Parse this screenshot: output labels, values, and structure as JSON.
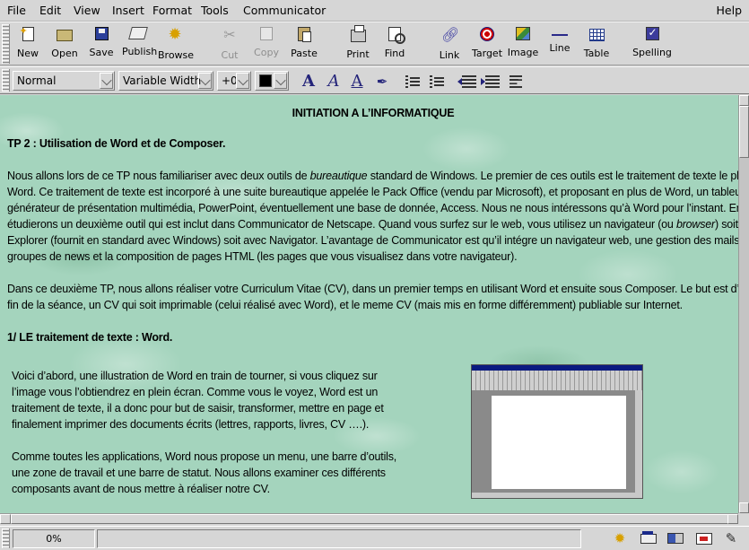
{
  "menu": {
    "file": "File",
    "edit": "Edit",
    "view": "View",
    "insert": "Insert",
    "format": "Format",
    "tools": "Tools",
    "communicator": "Communicator",
    "help": "Help"
  },
  "toolbar": {
    "new": "New",
    "open": "Open",
    "save": "Save",
    "publish": "Publish",
    "browse": "Browse",
    "cut": "Cut",
    "copy": "Copy",
    "paste": "Paste",
    "print": "Print",
    "find": "Find",
    "link": "Link",
    "target": "Target",
    "image": "Image",
    "line": "Line",
    "table": "Table",
    "spelling": "Spelling"
  },
  "format": {
    "paragraph_style": "Normal",
    "font": "Variable Width",
    "font_size": "+0",
    "text_color": "#000000"
  },
  "document": {
    "title": "INITIATION A L’INFORMATIQUE",
    "heading_tp": "TP 2 : Utilisation de Word et de Composer.",
    "para1": {
      "line1_pre": "Nous allons lors de ce TP nous familiariser avec deux outils de ",
      "line1_em": "bureautique",
      "line1_post": " standard de Windows. Le premier de ces outils est le traitement de texte le plus répandu :",
      "line2": "Word. Ce traitement de texte est incorporé à une suite bureautique appelée le Pack Office (vendu par Microsoft), et proposant en plus de Word, un tableur, Excel, un",
      "line3": "générateur de présentation multimédia, PowerPoint, éventuellement une base de donnée, Access. Nous ne nous intéressons qu’à Word pour l’instant. Ensuite nous",
      "line4": "étudierons un deuxième outil qui est inclut dans Communicator de Netscape. Quand vous surfez sur le web, vous utilisez un navigateur (ou ",
      "line4_em": "browser",
      "line4_post": ") soit Internet",
      "line5": "Explorer (fournit en standard avec Windows) soit avec Navigator. L’avantage de Communicator est qu’il intégre un navigateur web, une gestion des mails, des",
      "line6": "groupes de news et la composition de pages HTML (les pages que vous visualisez dans votre navigateur)."
    },
    "para2": {
      "line1": "Dans ce deuxième TP, nous allons réaliser votre Curriculum Vitae (CV), dans un premier temps en utilisant Word et ensuite sous Composer. Le but est d’avoir à la",
      "line2": "fin de la séance, un CV qui soit imprimable (celui réalisé avec Word), et le meme CV (mais mis en forme différemment) publiable sur Internet."
    },
    "heading_word": "1/ LE traitement de texte : Word.",
    "col1": {
      "line1": "Voici d’abord, une illustration de Word en train de tourner, si vous cliquez sur",
      "line2": "l’image vous l’obtiendrez  en plein écran. Comme vous le voyez, Word est un",
      "line3": "traitement de texte, il a donc pour but de saisir, transformer, mettre en page et",
      "line4": "finalement imprimer des documents écrits (lettres, rapports, livres, CV ….)."
    },
    "col2": {
      "line1": "Comme toutes les applications, Word nous propose un menu, une barre d’outils,",
      "line2": "une zone de travail et une barre de statut. Nous allons examiner ces différents",
      "line3": "composants avant de nous mettre à réaliser notre CV."
    },
    "background_color": "#a4d4bd"
  },
  "status": {
    "progress": "0%",
    "message": ""
  }
}
